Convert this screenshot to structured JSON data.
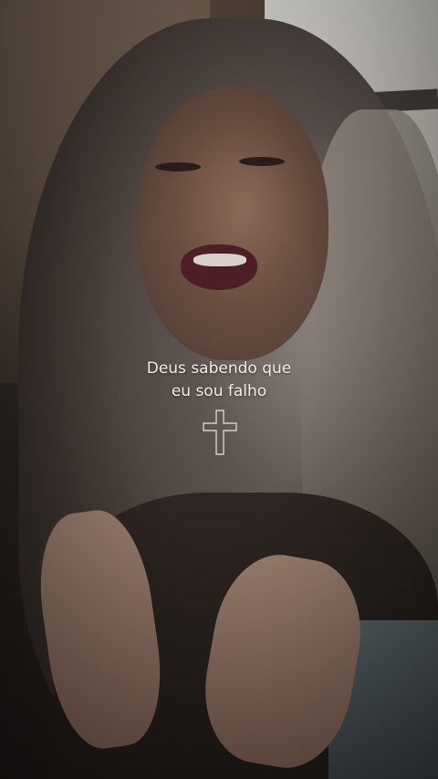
{
  "caption": {
    "line1": "Deus sabendo que",
    "line2": "eu sou falho"
  },
  "icons": {
    "cross": "cross-icon"
  },
  "colors": {
    "caption_text": "#f2ede8",
    "cross_outline": "#d9cfc6"
  }
}
